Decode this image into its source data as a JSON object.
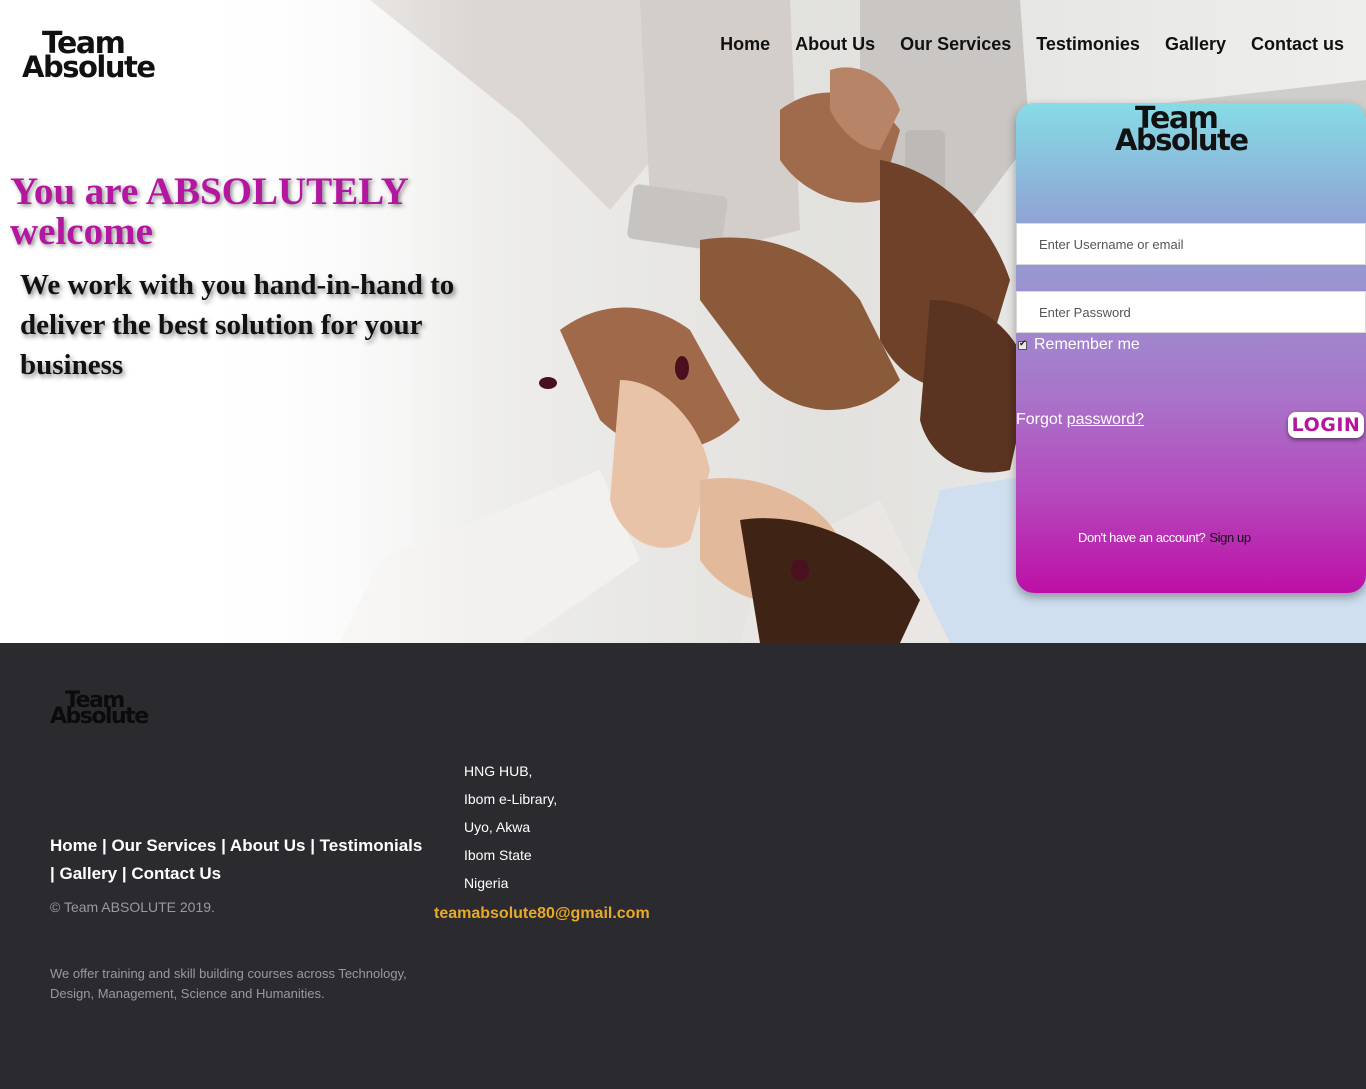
{
  "brand": {
    "line1": "Team",
    "line2": "Absolute"
  },
  "nav": {
    "items": [
      {
        "label": "Home"
      },
      {
        "label": "About Us"
      },
      {
        "label": "Our Services"
      },
      {
        "label": "Testimonies"
      },
      {
        "label": "Gallery"
      },
      {
        "label": "Contact us"
      }
    ]
  },
  "hero": {
    "headline": "You are ABSOLUTELY welcome",
    "subline": "We work with you hand-in-hand to deliver the best solution for your business"
  },
  "login": {
    "username_placeholder": "Enter Username or email",
    "password_placeholder": "Enter Password",
    "remember_label": "Remember me",
    "remember_checked": true,
    "forgot_prefix": "Forgot ",
    "forgot_link": "password?",
    "login_button": "LOGIN",
    "no_account_text": "Don't have an account?",
    "signup_link": "Sign up"
  },
  "footer": {
    "links": [
      "Home",
      "Our Services",
      "About Us",
      "Testimonials",
      "Gallery",
      "Contact Us"
    ],
    "copyright": "© Team ABSOLUTE 2019.",
    "description": "We offer training and skill building courses across Technology, Design, Management, Science and Humanities.",
    "address": [
      "HNG HUB,",
      "Ibom e-Library,",
      "Uyo, Akwa",
      "Ibom State",
      "Nigeria"
    ],
    "email": "teamabsolute80@gmail.com"
  },
  "colors": {
    "accent_magenta": "#b3169f",
    "card_top": "#86dce6",
    "card_bottom": "#bd0fa6",
    "footer_bg": "#2b2a2f",
    "email": "#e8a92a"
  },
  "icons": [
    "checkbox-check-icon"
  ]
}
